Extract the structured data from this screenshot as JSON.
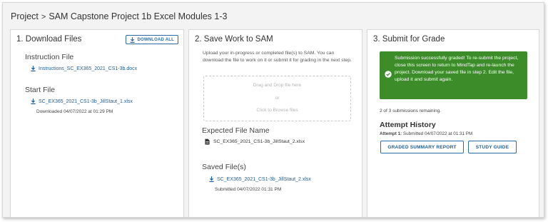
{
  "breadcrumb": {
    "root": "Project",
    "separator": ">",
    "current": "SAM Capstone Project 1b Excel Modules 1-3"
  },
  "panel1": {
    "title": "1. Download Files",
    "download_all_label": "DOWNLOAD ALL",
    "instruction_label": "Instruction File",
    "instruction_file": "Instructions_SC_EX365_2021_CS1-3b.docx",
    "start_label": "Start File",
    "start_file": "SC_EX365_2021_CS1-3b_JillStaut_1.xlsx",
    "start_downloaded": "Downloaded 04/07/2022 at 01:29 PM"
  },
  "panel2": {
    "title": "2. Save Work to SAM",
    "description": "Upload your in-progress or completed file(s) to SAM. You can download the file to work on it or submit it for grading in the next step.",
    "dropzone": {
      "line1": "Drag and Drop file here",
      "line2": "or",
      "line3": "Click to Browse files"
    },
    "expected_label": "Expected File Name",
    "expected_file": "SC_EX365_2021_CS1-3b_JillStaut_2.xlsx",
    "saved_label": "Saved File(s)",
    "saved_file": "SC_EX365_2021_CS1-3b_JillStaut_2.xlsx",
    "saved_submitted": "Submitted 04/07/2022 01:31 PM"
  },
  "panel3": {
    "title": "3. Submit for Grade",
    "success_message": "Submission successfully graded! To re-submit the project, close this screen to return to MindTap and re-launch the project. Download your saved file in step 2. Edit the file, upload it and submit again.",
    "remaining": "2 of 3 submissions remaining.",
    "attempt_history_title": "Attempt History",
    "attempt_label": "Attempt 1:",
    "attempt_detail": "Submitted 04/07/2022 at 01:31 PM",
    "graded_report_label": "GRADED SUMMARY REPORT",
    "study_guide_label": "STUDY GUIDE"
  },
  "colors": {
    "link": "#1d5e96",
    "success_bg": "#3c8c2a",
    "button_border": "#2a6ca8"
  }
}
